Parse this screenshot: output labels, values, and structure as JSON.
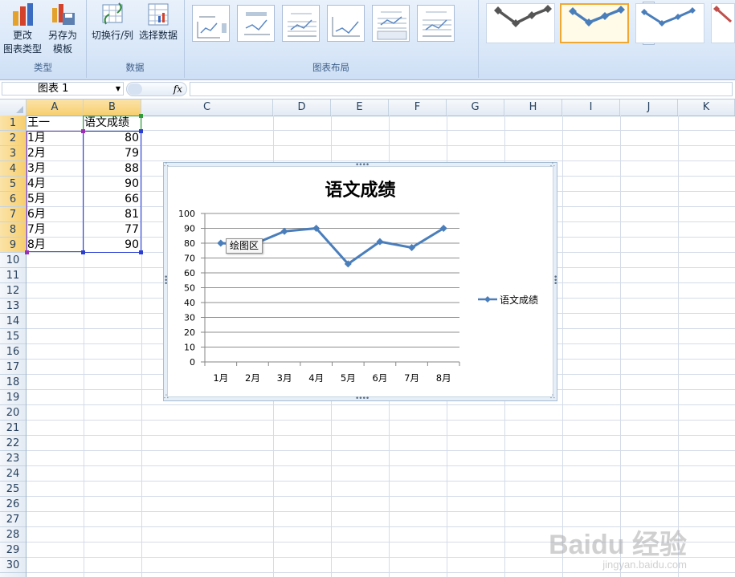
{
  "ribbon": {
    "type_group": {
      "title": "类型",
      "change_type": {
        "line1": "更改",
        "line2": "图表类型"
      },
      "save_template": {
        "line1": "另存为",
        "line2": "模板"
      }
    },
    "data_group": {
      "title": "数据",
      "switch_row_col": "切换行/列",
      "select_data": "选择数据"
    },
    "layout_group": {
      "title": "图表布局"
    }
  },
  "formula_bar": {
    "name_box": "图表 1",
    "fx_label": "fx",
    "formula": ""
  },
  "columns": [
    "A",
    "B",
    "C",
    "D",
    "E",
    "F",
    "G",
    "H",
    "I",
    "J",
    "K"
  ],
  "rows": [
    "1",
    "2",
    "3",
    "4",
    "5",
    "6",
    "7",
    "8",
    "9",
    "10",
    "11",
    "12",
    "13",
    "14",
    "15",
    "16",
    "17",
    "18",
    "19",
    "20",
    "21",
    "22",
    "23",
    "24",
    "25",
    "26",
    "27",
    "28",
    "29",
    "30"
  ],
  "sheet": {
    "header_a": "王一",
    "header_b": "语文成绩",
    "months": [
      "1月",
      "2月",
      "3月",
      "4月",
      "5月",
      "6月",
      "7月",
      "8月"
    ],
    "scores": [
      "80",
      "79",
      "88",
      "90",
      "66",
      "81",
      "77",
      "90"
    ]
  },
  "tooltip": "绘图区",
  "watermark": {
    "line1": "Baidu 经验",
    "line2": "jingyan.baidu.com"
  },
  "colors": {
    "series": "#4a7ebb",
    "accent_selected": "#f0a830",
    "selection_purple": "#9b30b5",
    "selection_blue": "#2a3fd2"
  },
  "chart_data": {
    "type": "line",
    "title": "语文成绩",
    "categories": [
      "1月",
      "2月",
      "3月",
      "4月",
      "5月",
      "6月",
      "7月",
      "8月"
    ],
    "series": [
      {
        "name": "语文成绩",
        "values": [
          80,
          79,
          88,
          90,
          66,
          81,
          77,
          90
        ],
        "marker": "diamond"
      }
    ],
    "ylim": [
      0,
      100
    ],
    "yticks": [
      "0",
      "10",
      "20",
      "30",
      "40",
      "50",
      "60",
      "70",
      "80",
      "90",
      "100"
    ],
    "xlabel": "",
    "ylabel": "",
    "grid": true,
    "legend": "right"
  }
}
